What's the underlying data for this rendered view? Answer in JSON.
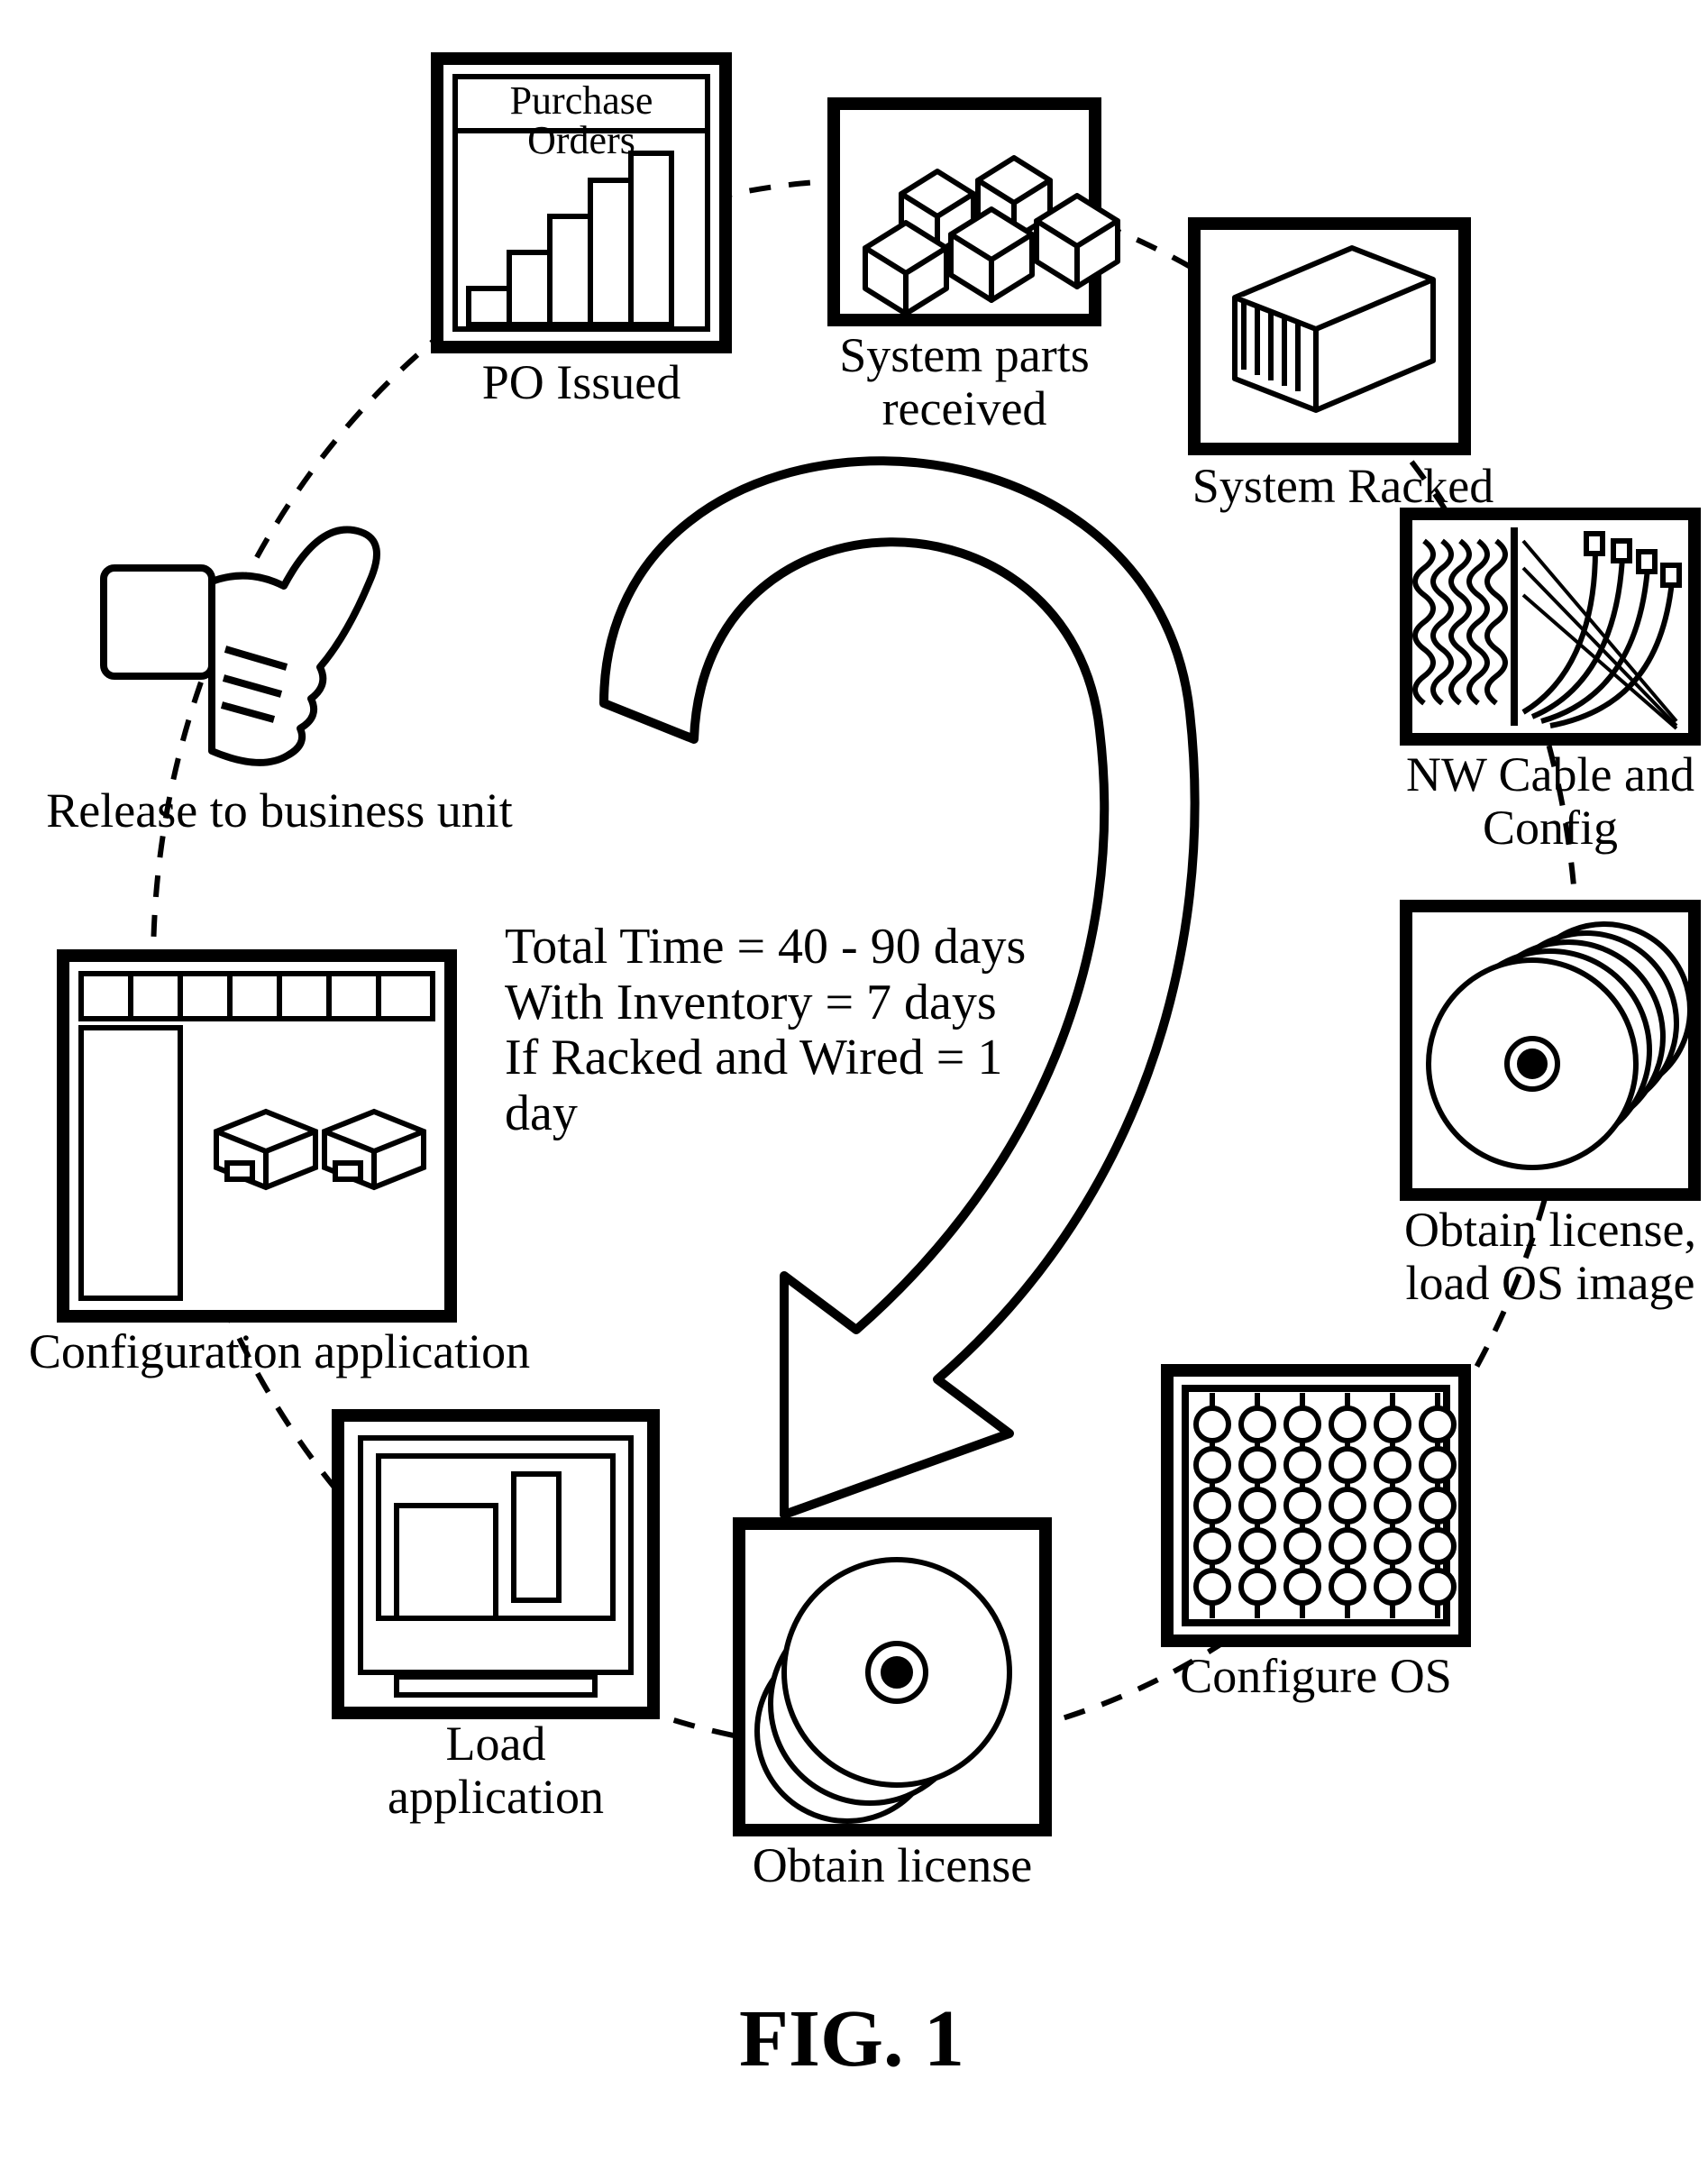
{
  "figure_label": "FIG. 1",
  "center_text": {
    "line1": "Total Time = 40 - 90 days",
    "line2": "With Inventory = 7 days",
    "line3": "If Racked and Wired = 1 day"
  },
  "nodes": {
    "po": {
      "label": "PO Issued",
      "title": "Purchase\nOrders"
    },
    "parts": {
      "label": "System parts\nreceived"
    },
    "racked": {
      "label": "System Racked"
    },
    "nwcable": {
      "label": "NW Cable and\nConfig"
    },
    "license_os": {
      "label": "Obtain license,\nload OS image"
    },
    "cfg_os": {
      "label": "Configure OS"
    },
    "license2": {
      "label": "Obtain license"
    },
    "load_app": {
      "label": "Load\napplication"
    },
    "cfg_app": {
      "label": "Configuration application"
    },
    "release": {
      "label": "Release to business unit"
    }
  }
}
